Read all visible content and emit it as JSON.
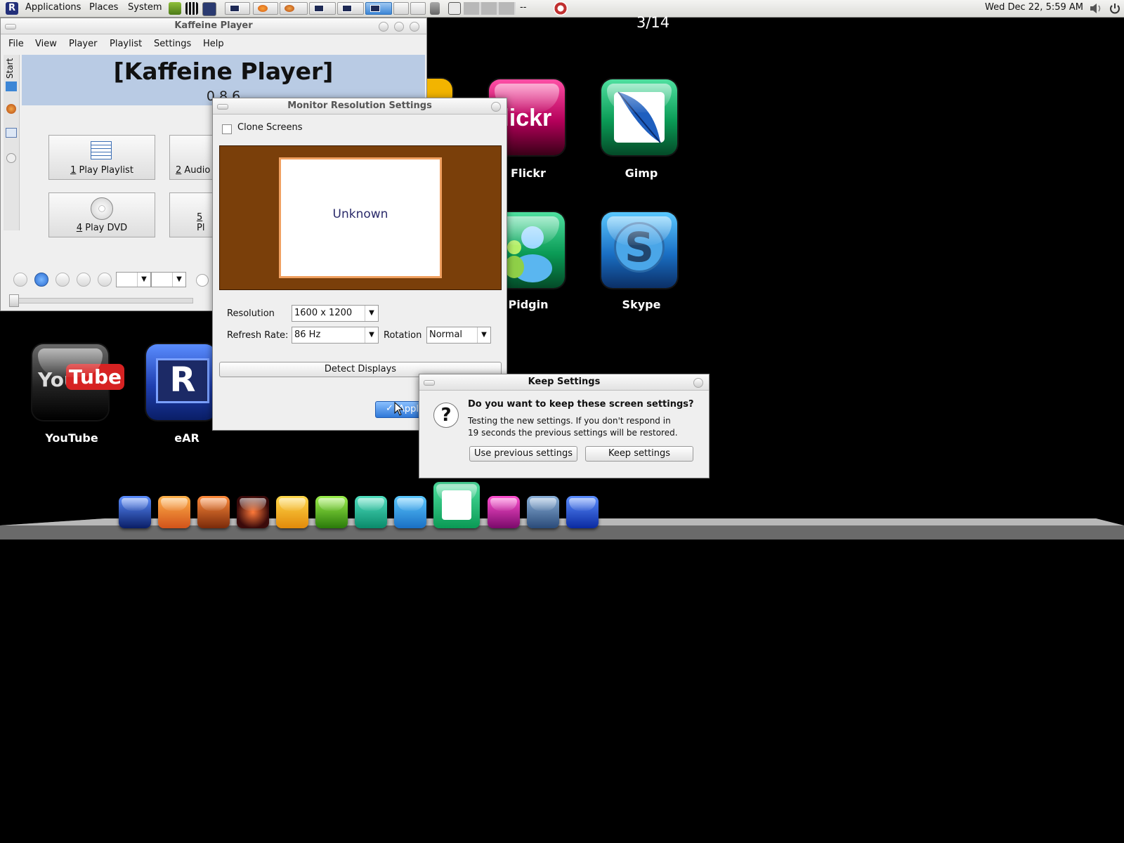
{
  "top_panel": {
    "menus": [
      "Applications",
      "Places",
      "System"
    ],
    "clock": "Wed Dec 22,  5:59 AM",
    "separator_text": "--"
  },
  "desktop": {
    "page_indicator": "3/14",
    "icons": [
      {
        "label": "Flickr",
        "text": "flickr"
      },
      {
        "label": "Gimp"
      },
      {
        "label": "Pidgin"
      },
      {
        "label": "Skype"
      },
      {
        "label": "YouTube",
        "text_a": "You",
        "text_b": "Tube"
      },
      {
        "label": "eAR"
      }
    ]
  },
  "kaffeine": {
    "title": "Kaffeine Player",
    "menu": [
      "File",
      "View",
      "Player",
      "Playlist",
      "Settings",
      "Help"
    ],
    "sidebar_label": "Start",
    "banner_title": "[Kaffeine Player]",
    "version": "0.8.6",
    "buttons": [
      {
        "key": "1",
        "label": " Play Playlist"
      },
      {
        "key": "2",
        "label": " Audio"
      },
      {
        "key": "4",
        "label": " Play DVD"
      },
      {
        "key": "5",
        "label": " Pl"
      }
    ]
  },
  "monitor_dialog": {
    "title": "Monitor Resolution Settings",
    "clone_label": "Clone Screens",
    "screen_name": "Unknown",
    "resolution_label": "Resolution",
    "resolution_value": "1600 x 1200",
    "refresh_label": "Refresh Rate:",
    "refresh_value": "86 Hz",
    "rotation_label": "Rotation",
    "rotation_value": "Normal",
    "detect_label": "Detect Displays",
    "apply_label": "Appl"
  },
  "keep_dialog": {
    "title": "Keep Settings",
    "question": "Do you want to keep these screen settings?",
    "body_line1": "Testing the new settings. If you don't respond in",
    "body_line2": "19 seconds the previous settings will be restored.",
    "use_previous": "Use previous settings",
    "keep": "Keep settings"
  },
  "colors": {
    "dock_accent": "#3d86d6",
    "banner": "#b9cbe4",
    "monitor_bg": "#7a3f0a"
  }
}
